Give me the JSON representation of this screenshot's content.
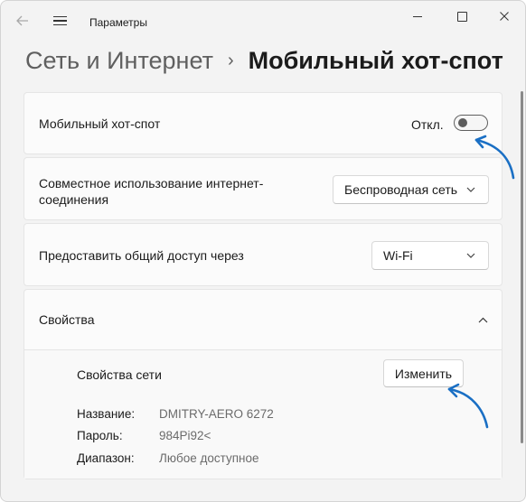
{
  "titlebar": {
    "title": "Параметры",
    "back_icon": "back-arrow-icon",
    "menu_icon": "hamburger-menu-icon",
    "controls": [
      "minimize",
      "maximize",
      "close"
    ]
  },
  "breadcrumb": {
    "parent": "Сеть и Интернет",
    "separator": "›",
    "current": "Мобильный хот-спот"
  },
  "hotspot": {
    "label": "Мобильный хот-спот",
    "toggle_state": "Откл.",
    "toggle_on": false
  },
  "sharing": {
    "label": "Совместное использование интернет-соединения",
    "selected": "Беспроводная сеть"
  },
  "share_via": {
    "label": "Предоставить общий доступ через",
    "selected": "Wi-Fi"
  },
  "properties": {
    "title": "Свойства",
    "expanded": true,
    "network_properties_label": "Свойства сети",
    "edit_button": "Изменить",
    "rows": [
      {
        "key": "Название:",
        "value": "DMITRY-AERO 6272"
      },
      {
        "key": "Пароль:",
        "value": "984Pi92<"
      },
      {
        "key": "Диапазон:",
        "value": "Любое доступное"
      }
    ]
  },
  "colors": {
    "window_bg": "#f3f3f3",
    "card_bg": "#fbfbfb",
    "annotation_arrow": "#1a6fc4",
    "secondary_text": "#6b6b6b"
  }
}
